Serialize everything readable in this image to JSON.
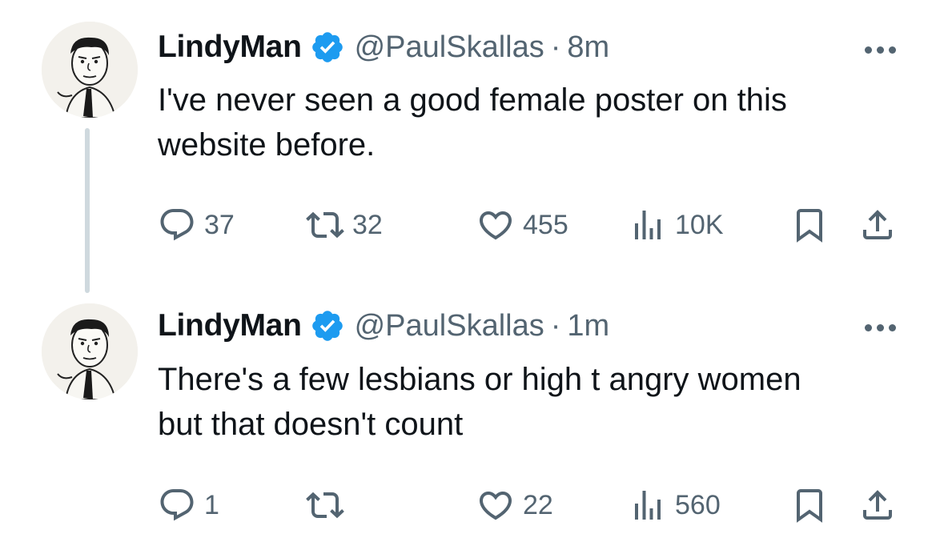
{
  "tweets": [
    {
      "display_name": "LindyMan",
      "handle": "@PaulSkallas",
      "separator": "·",
      "time": "8m",
      "text_lines": [
        "I've never seen a good female poster on this",
        "website before."
      ],
      "reply_count": "37",
      "retweet_count": "32",
      "like_count": "455",
      "view_count": "10K"
    },
    {
      "display_name": "LindyMan",
      "handle": "@PaulSkallas",
      "separator": "·",
      "time": "1m",
      "text_lines": [
        "There's a few lesbians or high t angry women",
        "but that doesn't count"
      ],
      "reply_count": "1",
      "retweet_count": "",
      "like_count": "22",
      "view_count": "560"
    }
  ],
  "icons": {
    "verified": "verified-badge-icon",
    "more": "more-options-icon",
    "reply": "reply-icon",
    "retweet": "retweet-icon",
    "like": "like-heart-icon",
    "views": "views-chart-icon",
    "bookmark": "bookmark-icon",
    "share": "share-icon"
  },
  "colors": {
    "text": "#0f1419",
    "secondary": "#536471",
    "verified": "#1d9bf0",
    "thread_line": "#cfd9de"
  }
}
